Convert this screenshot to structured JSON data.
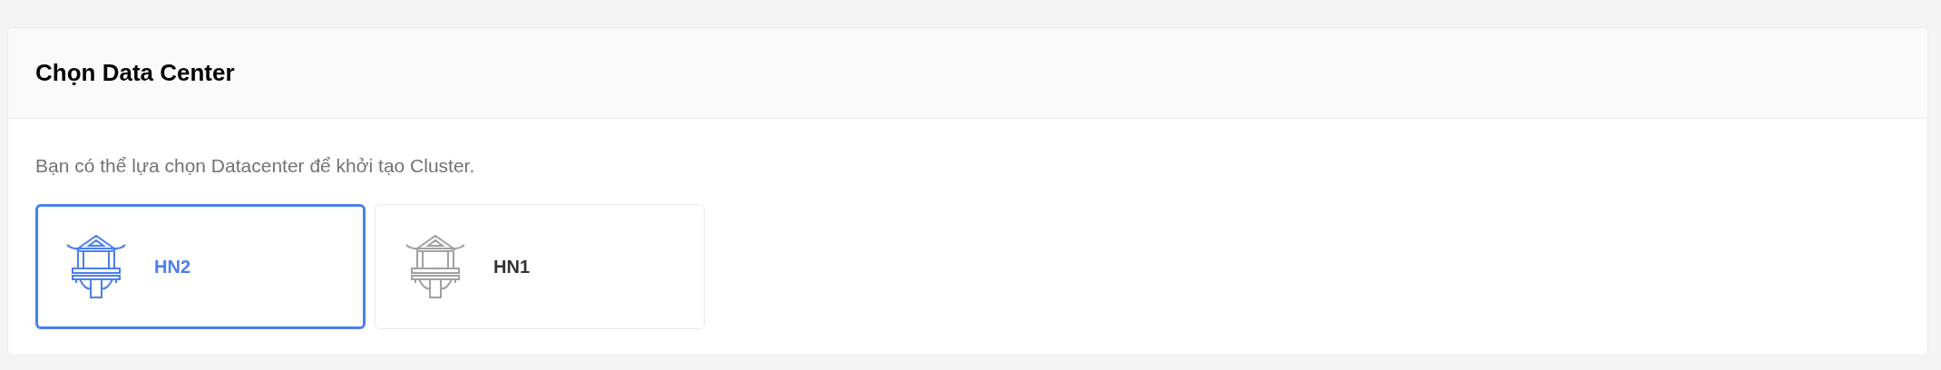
{
  "panel": {
    "title": "Chọn Data Center",
    "description": "Bạn có thể lựa chọn Datacenter để khởi tạo Cluster.",
    "options": [
      {
        "label": "HN2",
        "selected": true
      },
      {
        "label": "HN1",
        "selected": false
      }
    ]
  }
}
